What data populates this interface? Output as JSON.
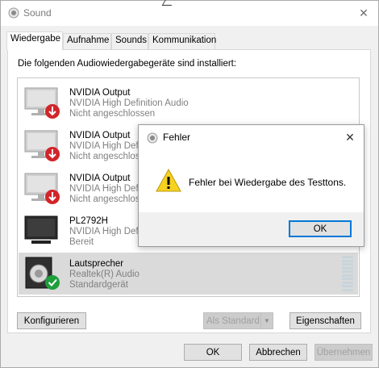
{
  "window": {
    "title": "Sound"
  },
  "tabs": [
    {
      "label": "Wiedergabe"
    },
    {
      "label": "Aufnahme"
    },
    {
      "label": "Sounds"
    },
    {
      "label": "Kommunikation"
    }
  ],
  "panel": {
    "heading": "Die folgenden Audiowiedergabegeräte sind installiert:"
  },
  "devices": [
    {
      "name": "NVIDIA Output",
      "driver": "NVIDIA High Definition Audio",
      "status": "Nicht angeschlossen",
      "icon": "monitor-disconnected-icon"
    },
    {
      "name": "NVIDIA Output",
      "driver": "NVIDIA High Def",
      "status": "Nicht angeschlos",
      "icon": "monitor-disconnected-icon"
    },
    {
      "name": "NVIDIA Output",
      "driver": "NVIDIA High Def",
      "status": "Nicht angeschlos",
      "icon": "monitor-disconnected-icon"
    },
    {
      "name": "PL2792H",
      "driver": "NVIDIA High Def",
      "status": "Bereit",
      "icon": "monitor-icon"
    },
    {
      "name": "Lautsprecher",
      "driver": "Realtek(R) Audio",
      "status": "Standardgerät",
      "icon": "speaker-default-icon"
    }
  ],
  "buttons": {
    "configure": "Konfigurieren",
    "set_default": "Als Standard",
    "properties": "Eigenschaften",
    "ok": "OK",
    "cancel": "Abbrechen",
    "apply": "Übernehmen"
  },
  "dialog": {
    "title": "Fehler",
    "message": "Fehler bei Wiedergabe des Testtons.",
    "ok": "OK"
  },
  "colors": {
    "accent": "#0078d7",
    "error_red": "#d1252a",
    "ok_green": "#1e9e3b",
    "warning_yellow": "#f7d21e"
  }
}
